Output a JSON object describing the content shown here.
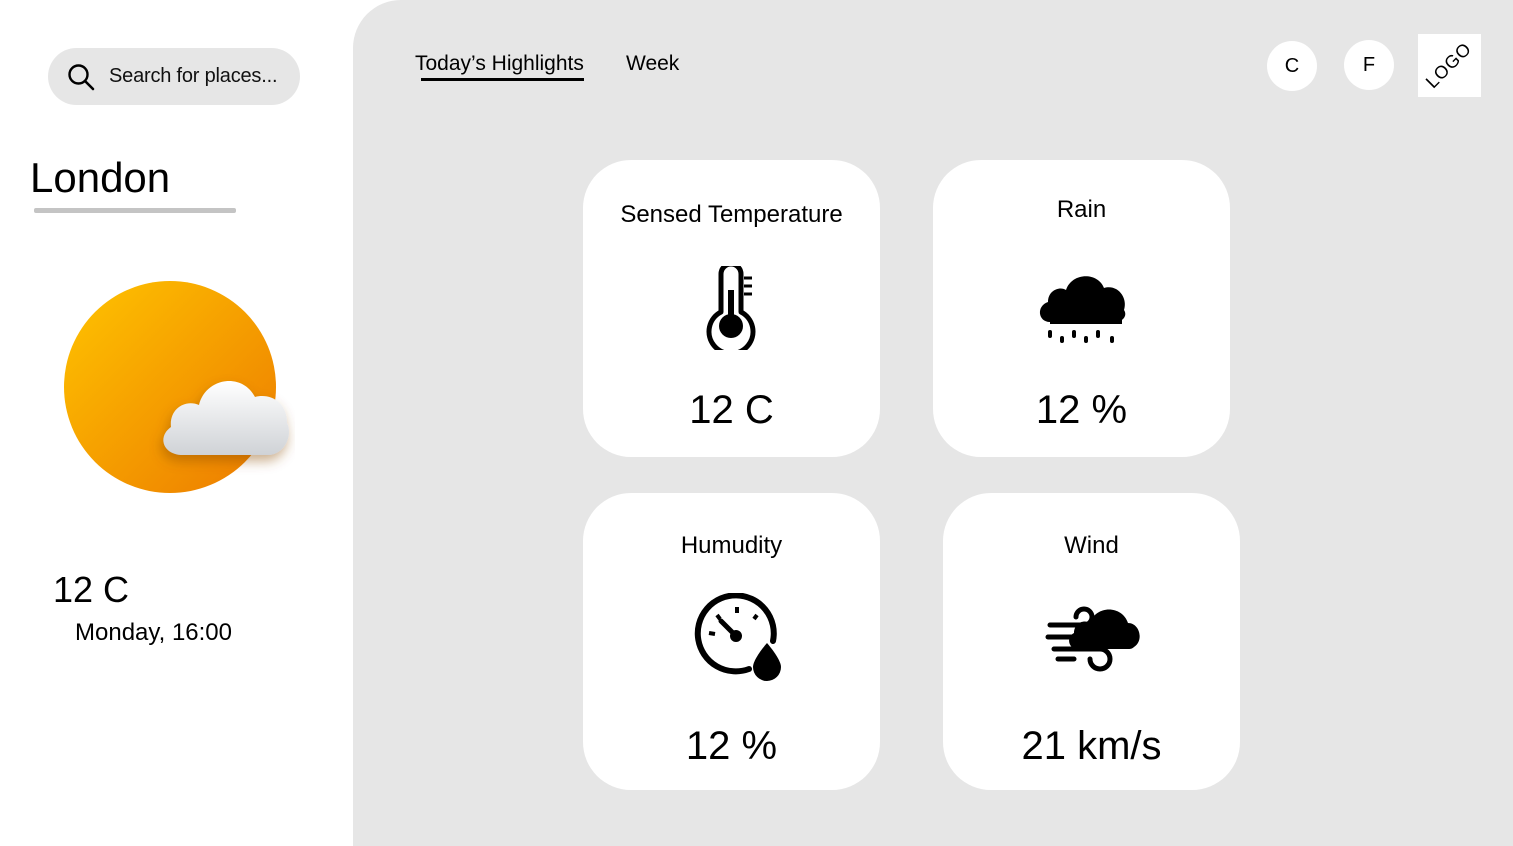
{
  "search": {
    "placeholder": "Search for places..."
  },
  "location": {
    "city": "London"
  },
  "current": {
    "temperature": "12 C",
    "datetime": "Monday, 16:00",
    "icon": "sun-cloud-icon"
  },
  "tabs": [
    {
      "label": "Today’s Highlights",
      "active": true
    },
    {
      "label": "Week",
      "active": false
    }
  ],
  "units": {
    "celsius": "C",
    "fahrenheit": "F"
  },
  "logo": "LOGO",
  "highlights": {
    "sensed_temperature": {
      "title": "Sensed Temperature",
      "value": "12 C",
      "icon": "thermometer-icon"
    },
    "rain": {
      "title": "Rain",
      "value": "12 %",
      "icon": "rain-cloud-icon"
    },
    "humidity": {
      "title": "Humudity",
      "value": "12 %",
      "icon": "gauge-droplet-icon"
    },
    "wind": {
      "title": "Wind",
      "value": "21 km/s",
      "icon": "wind-cloud-icon"
    }
  },
  "colors": {
    "panel_background": "#e6e6e6",
    "card_background": "#ffffff",
    "sun_orange": "#f08a00",
    "sun_yellow": "#ffc400"
  }
}
